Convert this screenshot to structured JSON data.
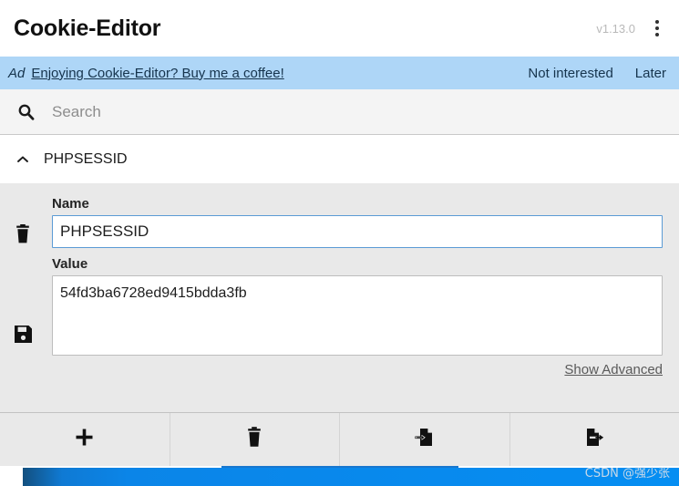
{
  "header": {
    "title": "Cookie-Editor",
    "version": "v1.13.0",
    "menu_icon": "kebab-menu-icon"
  },
  "ad": {
    "tag": "Ad",
    "link_text": "Enjoying Cookie-Editor? Buy me a coffee!",
    "not_interested_label": "Not interested",
    "later_label": "Later",
    "background_color": "#aed6f7",
    "text_color": "#16344d"
  },
  "search": {
    "placeholder": "Search",
    "value": "",
    "icon": "search-icon"
  },
  "cookie_list": [
    {
      "name": "PHPSESSID",
      "expanded": true,
      "chevron": "chevron-up-icon"
    }
  ],
  "form": {
    "name_label": "Name",
    "name_value": "PHPSESSID",
    "name_placeholder": "Name",
    "value_label": "Value",
    "value_value": "54fd3ba6728ed9415bdda3fb",
    "value_placeholder": "Value",
    "show_advanced_label": "Show Advanced",
    "delete_icon": "trash-icon",
    "save_icon": "save-floppy-icon",
    "focus_border_color": "#5b9bd5",
    "background_color": "#e9e9e9"
  },
  "toolbar": {
    "buttons": [
      {
        "name": "create-cookie",
        "icon": "plus-icon"
      },
      {
        "name": "delete-all-cookies",
        "icon": "trash-icon"
      },
      {
        "name": "import-cookies",
        "icon": "import-file-icon"
      },
      {
        "name": "export-cookies",
        "icon": "export-file-icon"
      }
    ]
  },
  "watermark": {
    "text": "CSDN @强少张"
  }
}
